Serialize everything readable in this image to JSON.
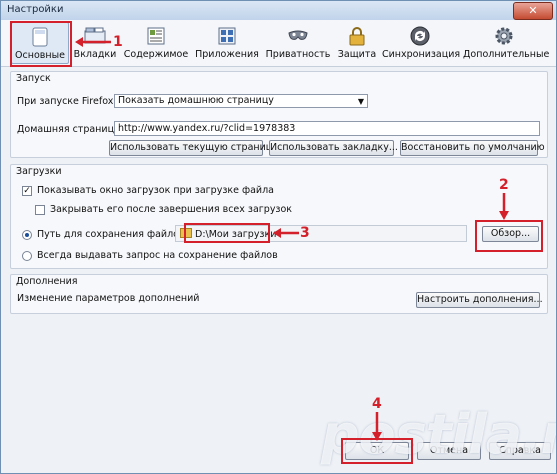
{
  "window": {
    "title": "Настройки",
    "close": "✕"
  },
  "tabs": [
    {
      "label": "Основные",
      "icon": "general-icon"
    },
    {
      "label": "Вкладки",
      "icon": "tabs-icon"
    },
    {
      "label": "Содержимое",
      "icon": "content-icon"
    },
    {
      "label": "Приложения",
      "icon": "applications-icon"
    },
    {
      "label": "Приватность",
      "icon": "privacy-mask-icon"
    },
    {
      "label": "Защита",
      "icon": "lock-icon"
    },
    {
      "label": "Синхронизация",
      "icon": "sync-icon"
    },
    {
      "label": "Дополнительные",
      "icon": "gear-icon"
    }
  ],
  "startup": {
    "group_title": "Запуск",
    "on_start_label": "При запуске Firefox:",
    "on_start_value": "Показать домашнюю страницу",
    "home_label": "Домашняя страница:",
    "home_value": "http://www.yandex.ru/?clid=1978383",
    "btn_current": "Использовать текущую страницу",
    "btn_bookmark": "Использовать закладку...",
    "btn_default": "Восстановить по умолчанию"
  },
  "downloads": {
    "group_title": "Загрузки",
    "show_window": "Показывать окно загрузок при загрузке файла",
    "close_after": "Закрывать его после завершения всех загрузок",
    "save_path_label": "Путь для сохранения файлов",
    "path_value": "D:\\Мои загрузки",
    "browse": "Обзор...",
    "always_ask": "Всегда выдавать запрос на сохранение файлов"
  },
  "addons": {
    "group_title": "Дополнения",
    "desc": "Изменение параметров дополнений",
    "btn": "Настроить дополнения..."
  },
  "footer": {
    "ok": "ОК",
    "cancel": "Отмена",
    "help": "Справка"
  },
  "annotations": {
    "n1": "1",
    "n2": "2",
    "n3": "3",
    "n4": "4"
  },
  "watermark": "postila.ru",
  "colors": {
    "annotation_red": "#d4202a",
    "accent": "#1c4f9a"
  }
}
